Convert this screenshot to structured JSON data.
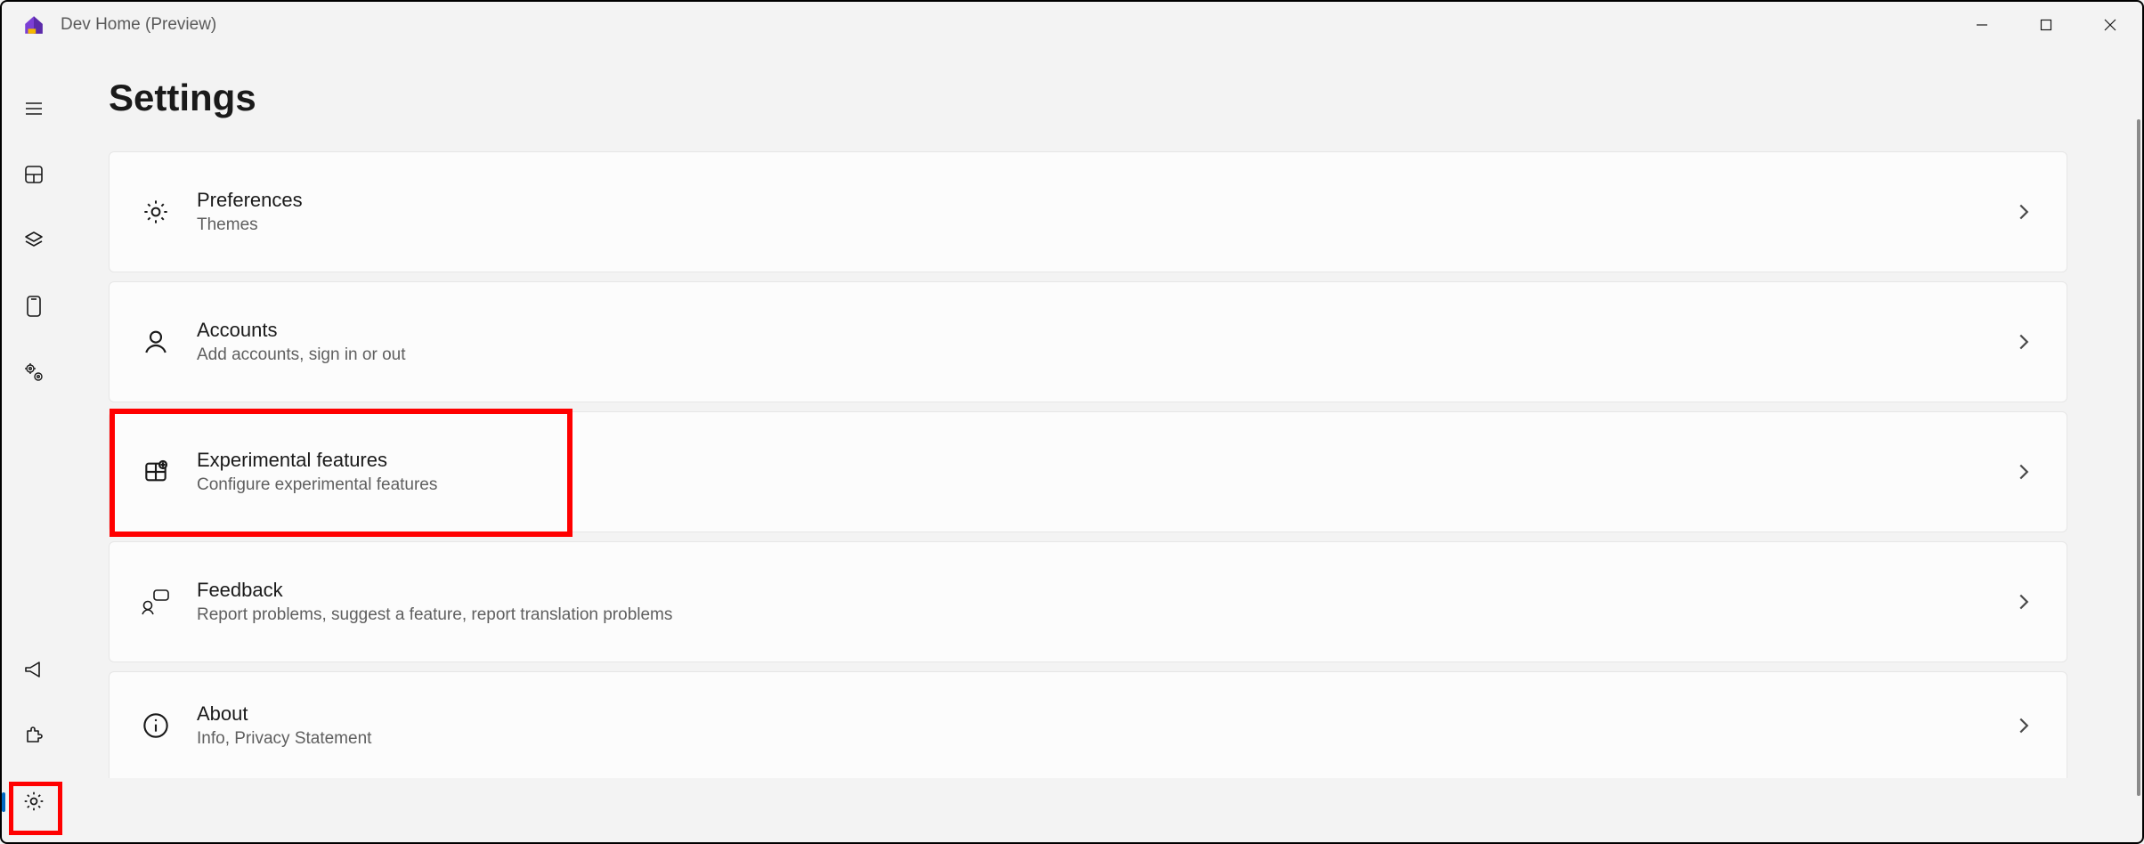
{
  "app": {
    "title": "Dev Home (Preview)"
  },
  "window_controls": {
    "minimize": "minimize",
    "maximize": "maximize",
    "close": "close"
  },
  "sidebar": {
    "top": [
      {
        "icon": "hamburger-icon",
        "name": "nav-toggle"
      },
      {
        "icon": "dashboard-icon",
        "name": "nav-dashboard"
      },
      {
        "icon": "layers-icon",
        "name": "nav-machine-config"
      },
      {
        "icon": "device-icon",
        "name": "nav-device"
      },
      {
        "icon": "gears-icon",
        "name": "nav-utilities"
      }
    ],
    "bottom": [
      {
        "icon": "megaphone-icon",
        "name": "nav-whatsnew"
      },
      {
        "icon": "puzzle-icon",
        "name": "nav-extensions"
      },
      {
        "icon": "gear-icon",
        "name": "nav-settings",
        "active": true,
        "highlighted": true
      }
    ]
  },
  "page": {
    "title": "Settings"
  },
  "settings_cards": [
    {
      "icon": "gear-icon",
      "title": "Preferences",
      "subtitle": "Themes"
    },
    {
      "icon": "person-icon",
      "title": "Accounts",
      "subtitle": "Add accounts, sign in or out"
    },
    {
      "icon": "experiment-icon",
      "title": "Experimental features",
      "subtitle": "Configure experimental features",
      "highlighted": true
    },
    {
      "icon": "feedback-icon",
      "title": "Feedback",
      "subtitle": "Report problems, suggest a feature, report translation problems"
    },
    {
      "icon": "info-icon",
      "title": "About",
      "subtitle": "Info, Privacy Statement"
    }
  ]
}
